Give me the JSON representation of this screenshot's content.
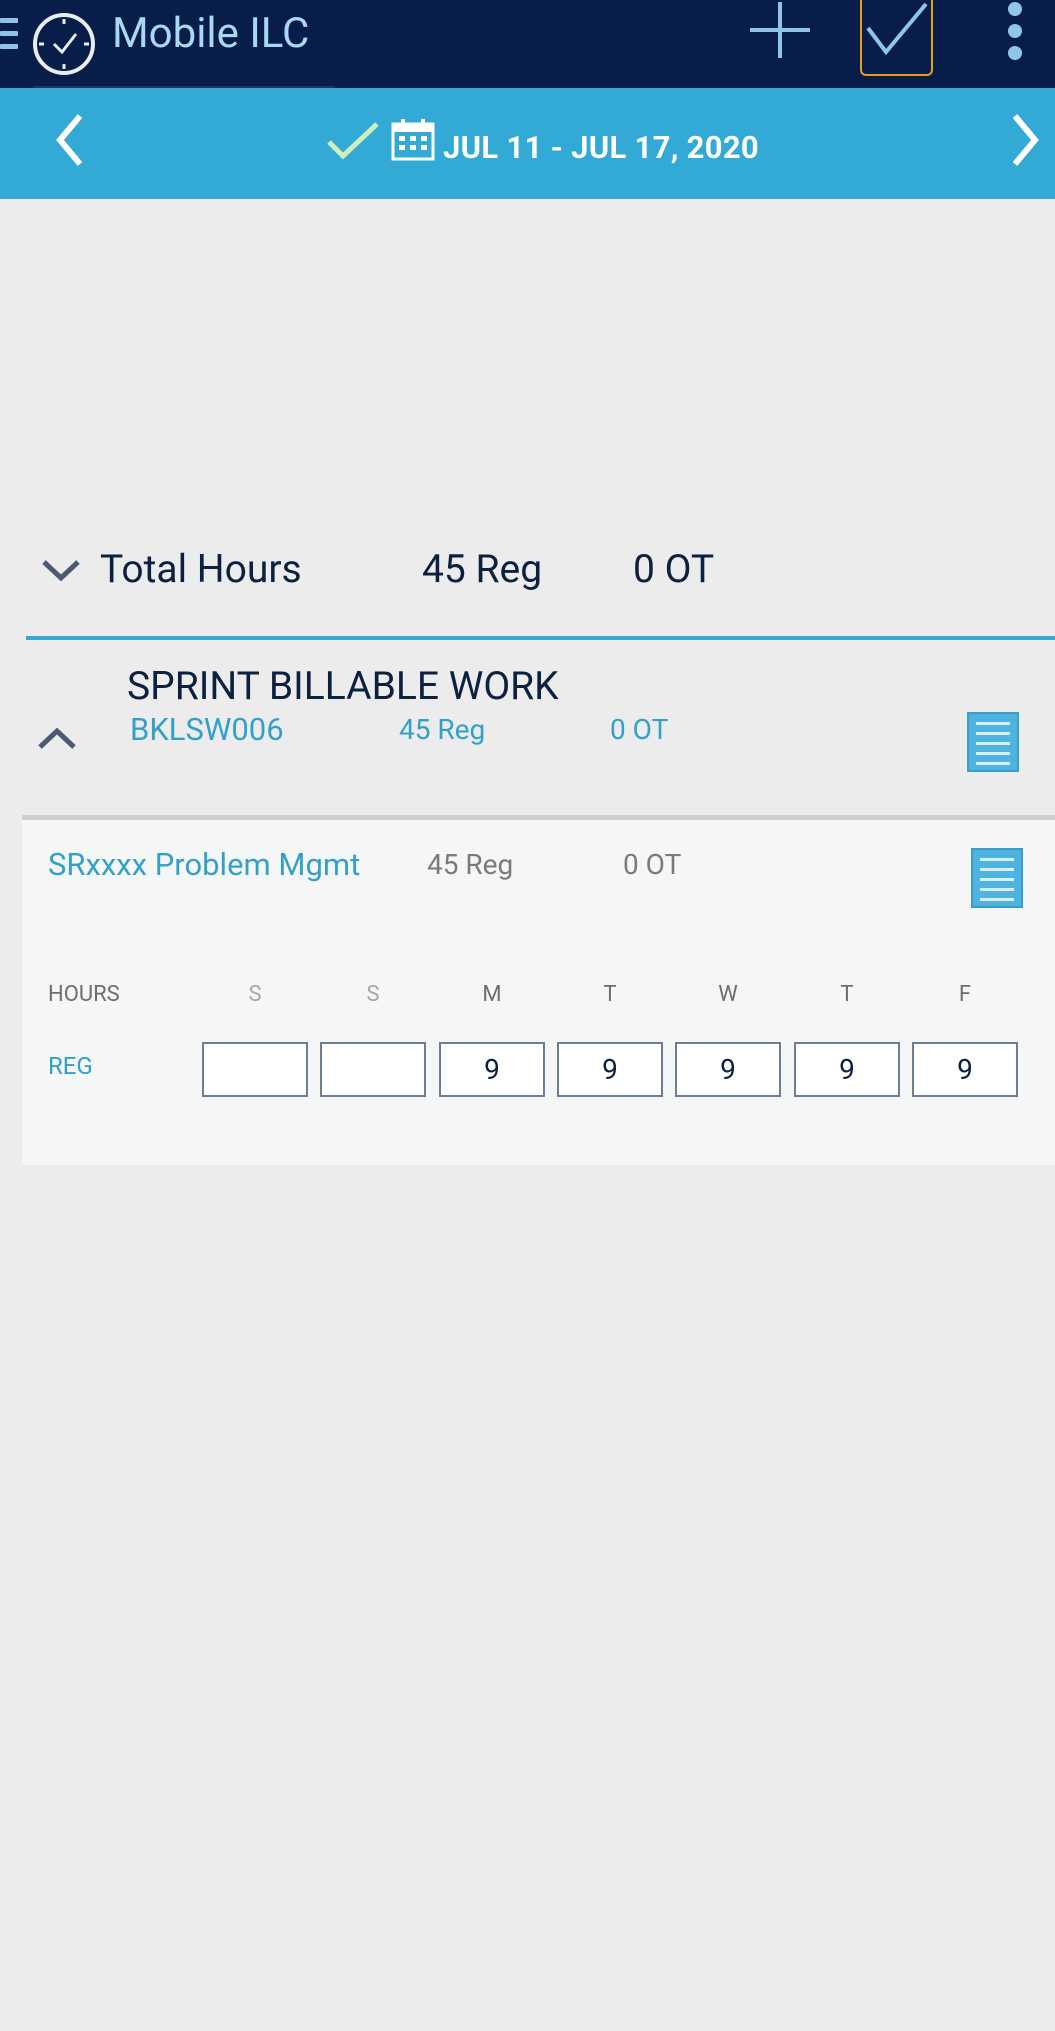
{
  "app": {
    "title": "Mobile ILC"
  },
  "week": {
    "range": "JUL 11 - JUL 17, 2020"
  },
  "total": {
    "label": "Total Hours",
    "reg": "45 Reg",
    "ot": "0 OT"
  },
  "project": {
    "name": "SPRINT BILLABLE WORK",
    "code": "BKLSW006",
    "reg": "45 Reg",
    "ot": "0 OT"
  },
  "task": {
    "name": "SRxxxx Problem Mgmt",
    "reg": "45 Reg",
    "ot": "0 OT",
    "hours_label": "HOURS",
    "row_label": "REG",
    "days": [
      "S",
      "S",
      "M",
      "T",
      "W",
      "T",
      "F"
    ],
    "values": [
      "",
      "",
      "9",
      "9",
      "9",
      "9",
      "9"
    ]
  },
  "icons": [
    "menu-icon",
    "clock-icon",
    "add-icon",
    "check-icon",
    "more-icon",
    "chevron-left-icon",
    "calendar-icon",
    "chevron-right-icon",
    "chevron-down-icon",
    "chevron-up-icon",
    "notes-icon"
  ],
  "colors": {
    "appbar": "#081d4a",
    "weekbar": "#33a9d5",
    "accent": "#33a0c9",
    "selected_border": "#e59f1a"
  }
}
